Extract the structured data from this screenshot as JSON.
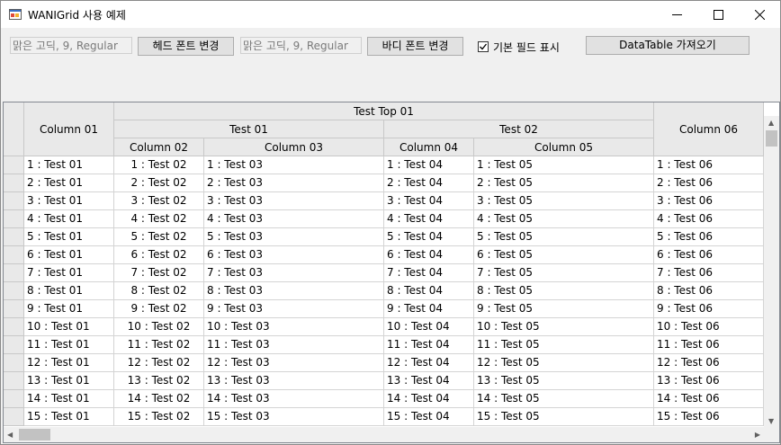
{
  "window": {
    "title": "WANIGrid 사용 예제",
    "controls": {
      "minimize": "—",
      "maximize": "☐",
      "close": "✕"
    }
  },
  "toolbar": {
    "head_font_value": "맑은 고딕, 9, Regular",
    "head_font_button": "헤드 폰트 변경",
    "body_font_value": "맑은 고딕, 9, Regular",
    "body_font_button": "바디 폰트 변경",
    "show_default_fields_label": "기본 필드 표시",
    "show_default_fields_checked": true,
    "datatable_button": "DataTable 가져오기"
  },
  "grid": {
    "header": {
      "top_group": "Test Top 01",
      "column_01": "Column 01",
      "group_test01": "Test 01",
      "group_test02": "Test 02",
      "column_02": "Column 02",
      "column_03": "Column 03",
      "column_04": "Column 04",
      "column_05": "Column 05",
      "column_06": "Column 06"
    },
    "rows": [
      [
        "1 : Test 01",
        "1 : Test 02",
        "1 : Test 03",
        "1 : Test 04",
        "1 : Test 05",
        "1 : Test 06"
      ],
      [
        "2 : Test 01",
        "2 : Test 02",
        "2 : Test 03",
        "2 : Test 04",
        "2 : Test 05",
        "2 : Test 06"
      ],
      [
        "3 : Test 01",
        "3 : Test 02",
        "3 : Test 03",
        "3 : Test 04",
        "3 : Test 05",
        "3 : Test 06"
      ],
      [
        "4 : Test 01",
        "4 : Test 02",
        "4 : Test 03",
        "4 : Test 04",
        "4 : Test 05",
        "4 : Test 06"
      ],
      [
        "5 : Test 01",
        "5 : Test 02",
        "5 : Test 03",
        "5 : Test 04",
        "5 : Test 05",
        "5 : Test 06"
      ],
      [
        "6 : Test 01",
        "6 : Test 02",
        "6 : Test 03",
        "6 : Test 04",
        "6 : Test 05",
        "6 : Test 06"
      ],
      [
        "7 : Test 01",
        "7 : Test 02",
        "7 : Test 03",
        "7 : Test 04",
        "7 : Test 05",
        "7 : Test 06"
      ],
      [
        "8 : Test 01",
        "8 : Test 02",
        "8 : Test 03",
        "8 : Test 04",
        "8 : Test 05",
        "8 : Test 06"
      ],
      [
        "9 : Test 01",
        "9 : Test 02",
        "9 : Test 03",
        "9 : Test 04",
        "9 : Test 05",
        "9 : Test 06"
      ],
      [
        "10 : Test 01",
        "10 : Test 02",
        "10 : Test 03",
        "10 : Test 04",
        "10 : Test 05",
        "10 : Test 06"
      ],
      [
        "11 : Test 01",
        "11 : Test 02",
        "11 : Test 03",
        "11 : Test 04",
        "11 : Test 05",
        "11 : Test 06"
      ],
      [
        "12 : Test 01",
        "12 : Test 02",
        "12 : Test 03",
        "12 : Test 04",
        "12 : Test 05",
        "12 : Test 06"
      ],
      [
        "13 : Test 01",
        "13 : Test 02",
        "13 : Test 03",
        "13 : Test 04",
        "13 : Test 05",
        "13 : Test 06"
      ],
      [
        "14 : Test 01",
        "14 : Test 02",
        "14 : Test 03",
        "14 : Test 04",
        "14 : Test 05",
        "14 : Test 06"
      ],
      [
        "15 : Test 01",
        "15 : Test 02",
        "15 : Test 03",
        "15 : Test 04",
        "15 : Test 05",
        "15 : Test 06"
      ]
    ]
  },
  "icons": {
    "app": "app-window-icon",
    "check": "checkmark-icon",
    "scroll_up": "arrow-up-icon",
    "scroll_down": "arrow-down-icon",
    "scroll_left": "arrow-left-icon",
    "scroll_right": "arrow-right-icon"
  }
}
